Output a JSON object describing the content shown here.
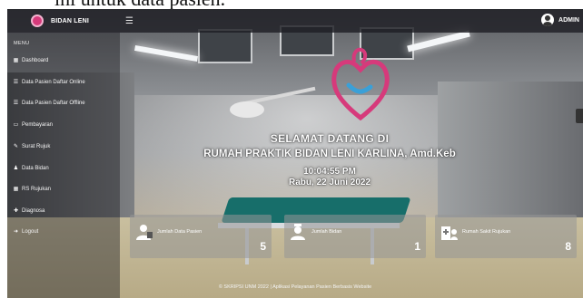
{
  "caption": "ini",
  "topbar": {
    "brand_name": "BIDAN LENI",
    "user_name": "ADMIN"
  },
  "sidebar": {
    "heading": "MENU",
    "items": [
      {
        "label": "Dashboard",
        "icon": "calendar-icon"
      },
      {
        "label": "Data Pasien Daftar Online",
        "icon": "list-icon"
      },
      {
        "label": "Data Pasien Daftar Offline",
        "icon": "list-icon"
      },
      {
        "label": "Pembayaran",
        "icon": "money-icon"
      },
      {
        "label": "Surat Rujuk",
        "icon": "document-icon"
      },
      {
        "label": "Data Bidan",
        "icon": "user-icon"
      },
      {
        "label": "RS Rujukan",
        "icon": "building-icon"
      },
      {
        "label": "Diagnosa",
        "icon": "stethoscope-icon"
      },
      {
        "label": "Logout",
        "icon": "logout-icon"
      }
    ]
  },
  "hero": {
    "line1": "SELAMAT DATANG DI",
    "line2": "RUMAH PRAKTIK BIDAN LENI KARLINA, Amd.Keb",
    "time": "10:04:55 PM",
    "date": "Rabu, 22 Juni 2022"
  },
  "cards": [
    {
      "label": "Jumlah Data Pasien",
      "value": "5",
      "icon": "patient-icon"
    },
    {
      "label": "Jumlah Bidan",
      "value": "1",
      "icon": "nurse-icon"
    },
    {
      "label": "Rumah Sakit Rujukan",
      "value": "8",
      "icon": "hospital-icon"
    }
  ],
  "footer": "© SKRIPSI UNM 2022 | Aplikasi Pelayanan Pasien Berbasis Website",
  "colors": {
    "logo_pink": "#d63a7b",
    "logo_blue": "#3aa0d8"
  }
}
